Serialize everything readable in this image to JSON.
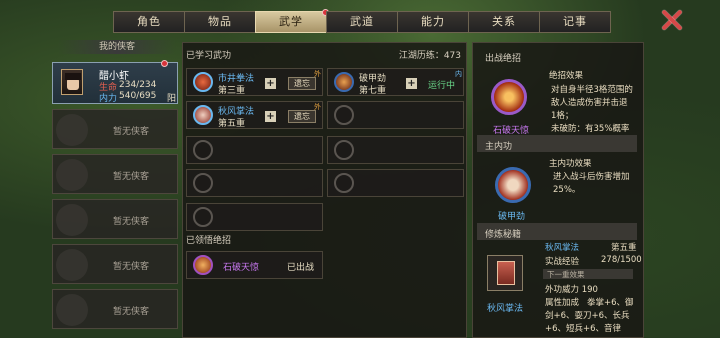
{
  "tabs": [
    {
      "label": "角色",
      "active": false,
      "badge": false
    },
    {
      "label": "物品",
      "active": false,
      "badge": false
    },
    {
      "label": "武学",
      "active": true,
      "badge": true
    },
    {
      "label": "武道",
      "active": false,
      "badge": false
    },
    {
      "label": "能力",
      "active": false,
      "badge": false
    },
    {
      "label": "关系",
      "active": false,
      "badge": false
    },
    {
      "label": "记事",
      "active": false,
      "badge": false
    }
  ],
  "sidebar": {
    "title": "我的侠客",
    "hero": {
      "name": "醋小虾",
      "hp_label": "生命",
      "hp": "234/234",
      "mp_label": "内力",
      "mp": "540/695",
      "tag": "阳"
    },
    "empty_label": "暂无侠客"
  },
  "learned": {
    "title": "已学习武功",
    "jianghu": "江湖历练：473",
    "skills": [
      {
        "name": "市井拳法",
        "level": "第三重",
        "forget": "遗忘",
        "corner": "外",
        "name_color": "#6ab8f0"
      },
      {
        "name": "破甲劲",
        "level": "第七重",
        "status": "运行中",
        "corner": "内",
        "name_color": "#e8dcc0"
      },
      {
        "name": "秋风掌法",
        "level": "第五重",
        "forget": "遗忘",
        "corner": "外",
        "name_color": "#6ab8f0"
      }
    ]
  },
  "ultimates": {
    "title": "已领悟绝招",
    "item": {
      "name": "石破天惊",
      "status": "已出战"
    }
  },
  "right": {
    "battle": {
      "title": "出战绝招",
      "icon_name": "石破天惊",
      "effect_title": "绝招效果",
      "effect_text": [
        "对自身半径3格范围的",
        "敌人造成伤害并击退",
        "1格；",
        "未破防：有35%概率"
      ]
    },
    "inner": {
      "title": "主内功",
      "icon_name": "破甲劲",
      "effect_title": "主内功效果",
      "effect_text": [
        "进入战斗后伤害增加",
        "25%。"
      ]
    },
    "manual": {
      "title": "修炼秘籍",
      "icon_name": "秋风掌法",
      "skill": "秋风掌法",
      "level": "第五重",
      "exp_label": "实战经验",
      "exp": "278/1500",
      "next_label": "下一重效果",
      "power": "外功威力 190",
      "attr_label": "属性加成",
      "attr_lines": [
        "拳掌+6、御",
        "剑+6、耍刀+6、长兵",
        "+6、短兵+6、音律"
      ]
    }
  }
}
